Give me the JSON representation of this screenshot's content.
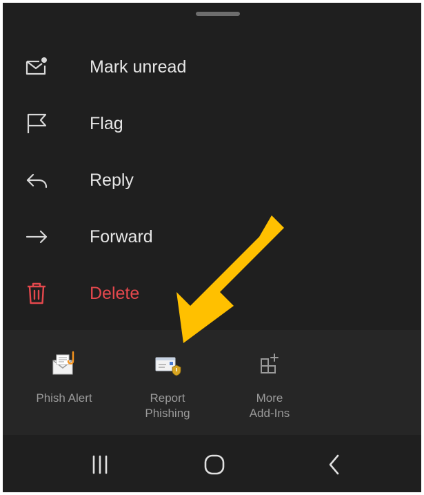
{
  "menu": {
    "items": [
      {
        "id": "mark-unread",
        "label": "Mark unread",
        "icon": "mail-unread-icon"
      },
      {
        "id": "flag",
        "label": "Flag",
        "icon": "flag-icon"
      },
      {
        "id": "reply",
        "label": "Reply",
        "icon": "reply-icon"
      },
      {
        "id": "forward",
        "label": "Forward",
        "icon": "forward-icon"
      },
      {
        "id": "delete",
        "label": "Delete",
        "icon": "trash-icon"
      }
    ]
  },
  "addins": {
    "items": [
      {
        "id": "phish-alert",
        "label": "Phish Alert",
        "icon": "phish-alert-icon"
      },
      {
        "id": "report-phishing",
        "label": "Report\nPhishing",
        "icon": "report-phishing-icon"
      },
      {
        "id": "more-addins",
        "label": "More\nAdd-Ins",
        "icon": "add-grid-icon"
      }
    ]
  },
  "navbar": {
    "buttons": [
      {
        "id": "recents",
        "icon": "recents-icon"
      },
      {
        "id": "home",
        "icon": "home-icon"
      },
      {
        "id": "back",
        "icon": "back-icon"
      }
    ]
  },
  "colors": {
    "background": "#1f1f1f",
    "addin_background": "#262626",
    "text": "#e6e6e6",
    "muted_text": "#9a9a9a",
    "danger": "#e5484d",
    "arrow": "#ffc000"
  }
}
